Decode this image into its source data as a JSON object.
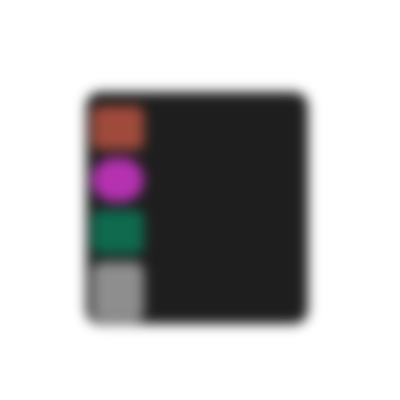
{
  "header": {
    "title": "",
    "subtitle": ""
  },
  "panel": {
    "rows": [
      {
        "label": "",
        "swatch_color": "#a04a3c"
      },
      {
        "label": "",
        "swatch_color": "#b531b0"
      },
      {
        "label": "",
        "swatch_color": "#0f6a4e"
      },
      {
        "label": "",
        "swatch_color": "#8e8e8e"
      }
    ]
  }
}
